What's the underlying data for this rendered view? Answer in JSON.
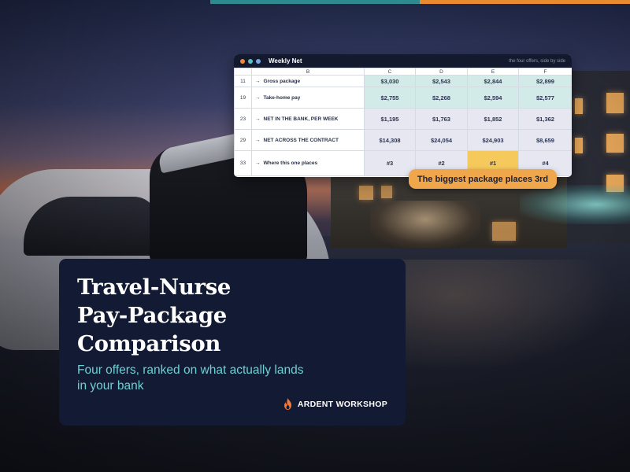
{
  "sheet": {
    "title": "Weekly Net",
    "subtitle": "the four offers, side by side",
    "columns": [
      "B",
      "C",
      "D",
      "E",
      "F"
    ],
    "rows": [
      {
        "num": "11",
        "label": "Gross package",
        "values": [
          "$3,030",
          "$2,543",
          "$2,844",
          "$2,899"
        ]
      },
      {
        "num": "19",
        "label": "Take-home pay",
        "values": [
          "$2,755",
          "$2,268",
          "$2,594",
          "$2,577"
        ]
      },
      {
        "num": "23",
        "label": "NET IN THE BANK, PER WEEK",
        "values": [
          "$1,195",
          "$1,763",
          "$1,852",
          "$1,362"
        ]
      },
      {
        "num": "29",
        "label": "NET ACROSS THE CONTRACT",
        "values": [
          "$14,308",
          "$24,054",
          "$24,903",
          "$8,659"
        ]
      },
      {
        "num": "33",
        "label": "Where this one places",
        "values": [
          "#3",
          "#2",
          "#1",
          "#4"
        ]
      }
    ],
    "arrow_glyph": "→"
  },
  "callout": "The biggest package places 3rd",
  "card": {
    "title_lines": [
      "Travel-Nurse",
      "Pay-Package",
      "Comparison"
    ],
    "subtitle": "Four offers, ranked on what actually lands in your bank"
  },
  "brand": {
    "name": "ARDENT WORKSHOP",
    "icon": "flame-icon"
  },
  "colors": {
    "accent_teal": "#2f8a90",
    "accent_orange": "#e88a30",
    "highlight_yellow": "#f6c95c",
    "card_bg": "#131a33",
    "subtitle_teal": "#6fd0d4"
  }
}
